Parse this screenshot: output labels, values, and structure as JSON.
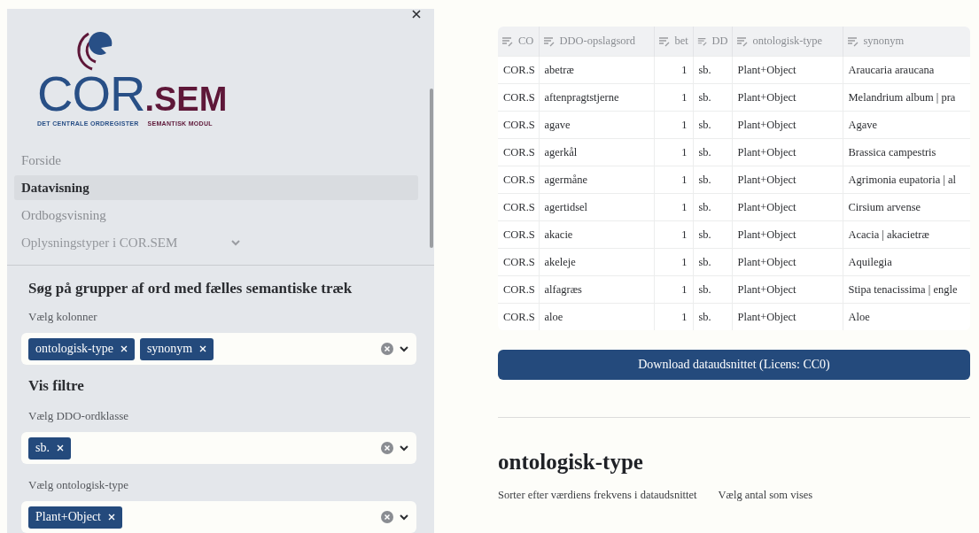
{
  "logo": {
    "name_main": "COR",
    "name_suffix": ".SEM",
    "subtitle_left": "DET CENTRALE ORDREGISTER",
    "subtitle_right": "SEMANTISK MODUL"
  },
  "nav": [
    {
      "label": "Forside",
      "selected": false,
      "kind": "link"
    },
    {
      "label": "Datavisning",
      "selected": true,
      "kind": "link"
    },
    {
      "label": "Ordbogsvisning",
      "selected": false,
      "kind": "link"
    },
    {
      "label": "Oplysningstyper i COR.SEM",
      "selected": false,
      "kind": "group"
    }
  ],
  "filters": {
    "title": "Søg på grupper af ord med fælles semantiske træk",
    "columns_field": {
      "label": "Vælg kolonner",
      "tags": [
        "ontologisk-type",
        "synonym"
      ]
    },
    "subtitle": "Vis filtre",
    "fields": [
      {
        "label": "Vælg DDO-ordklasse",
        "tags": [
          "sb."
        ]
      },
      {
        "label": "Vælg ontologisk-type",
        "tags": [
          "Plant+Object"
        ]
      }
    ]
  },
  "table": {
    "columns": [
      {
        "label": "CO"
      },
      {
        "label": "DDO-opslagsord"
      },
      {
        "label": "bet"
      },
      {
        "label": "DD"
      },
      {
        "label": "ontologisk-type"
      },
      {
        "label": "synonym"
      }
    ],
    "rows": [
      [
        "COR.S",
        "abetræ",
        "1",
        "sb.",
        "Plant+Object",
        "Araucaria araucana"
      ],
      [
        "COR.S",
        "aftenpragtstjerne",
        "1",
        "sb.",
        "Plant+Object",
        "Melandrium album | pra"
      ],
      [
        "COR.S",
        "agave",
        "1",
        "sb.",
        "Plant+Object",
        "Agave"
      ],
      [
        "COR.S",
        "agerkål",
        "1",
        "sb.",
        "Plant+Object",
        "Brassica campestris"
      ],
      [
        "COR.S",
        "agermåne",
        "1",
        "sb.",
        "Plant+Object",
        "Agrimonia eupatoria | al"
      ],
      [
        "COR.S",
        "agertidsel",
        "1",
        "sb.",
        "Plant+Object",
        "Cirsium arvense"
      ],
      [
        "COR.S",
        "akacie",
        "1",
        "sb.",
        "Plant+Object",
        "Acacia | akacietræ"
      ],
      [
        "COR.S",
        "akeleje",
        "1",
        "sb.",
        "Plant+Object",
        "Aquilegia"
      ],
      [
        "COR.S",
        "alfagræs",
        "1",
        "sb.",
        "Plant+Object",
        "Stipa tenacissima | engle"
      ],
      [
        "COR.S",
        "aloe",
        "1",
        "sb.",
        "Plant+Object",
        "Aloe"
      ]
    ]
  },
  "download_button": "Download dataudsnittet (Licens: CC0)",
  "section": {
    "title": "ontologisk-type",
    "sort_label": "Sorter efter værdiens frekvens i dataudsnittet",
    "count_label": "Vælg antal som vises"
  }
}
